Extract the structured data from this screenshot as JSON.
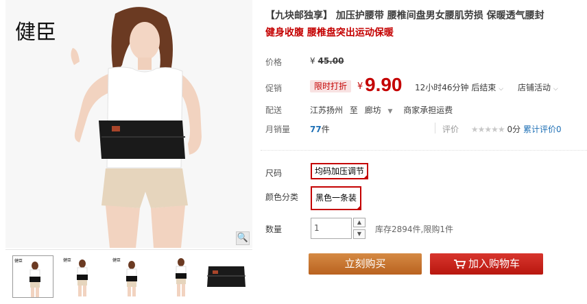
{
  "gallery": {
    "brand_mark": "健臣",
    "zoom_icon": "magnifier-icon",
    "thumbnails": [
      {
        "label": "健臣"
      },
      {
        "label": "健臣"
      },
      {
        "label": "健臣"
      },
      {
        "label": ""
      },
      {
        "label": ""
      }
    ]
  },
  "product": {
    "title": "【九块邮独享】 加压护腰带 腰椎间盘男女腰肌劳损 保暖透气腰封",
    "subtitle": "健身收腹 腰椎盘突出运动保暖"
  },
  "price": {
    "label": "价格",
    "currency": "¥",
    "original": "45.00",
    "promo_label": "促销",
    "promo_badge": "限时打折",
    "current": "9.90",
    "countdown": "12小时46分钟 后结束",
    "store_activity": "店铺活动"
  },
  "delivery": {
    "label": "配送",
    "from": "江苏扬州",
    "to_word": "至",
    "to": "廊坊",
    "fee": "商家承担运费"
  },
  "sales": {
    "label": "月销量",
    "count": "77",
    "unit": "件",
    "rating_label": "评价",
    "stars": "★★★★★",
    "score": "0分",
    "cumulative": "累计评价0"
  },
  "options": {
    "size_label": "尺码",
    "size_value": "均码加压调节",
    "color_label": "颜色分类",
    "color_value": "黑色一条装",
    "qty_label": "数量",
    "qty_value": "1",
    "stock": "库存2894件,限购1件"
  },
  "actions": {
    "buy": "立刻购买",
    "cart": "加入购物车"
  },
  "colors": {
    "accent_red": "#c40000",
    "buy_orange": "#c8712e",
    "cart_red": "#c8201a",
    "link_blue": "#1d6fb5"
  }
}
